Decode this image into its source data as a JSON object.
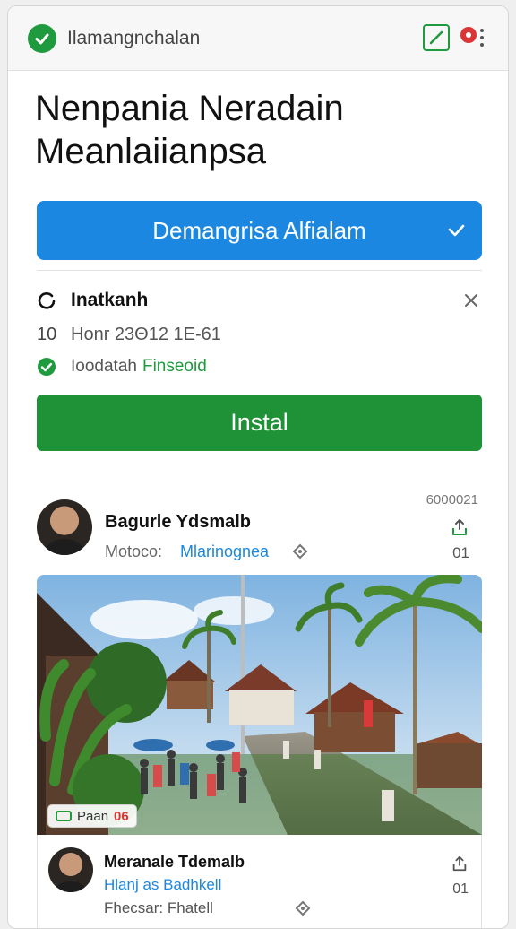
{
  "topbar": {
    "title": "Ilamangnchalan",
    "icons": [
      "check-circle-icon",
      "edit-icon",
      "record-icon",
      "more-vert-icon"
    ]
  },
  "headline": {
    "line1": "Nenpania Neradain",
    "line2": "Meanlaiianpsa"
  },
  "primary_button": {
    "label": "Demangrisa Alfialam"
  },
  "app_info": {
    "name": "Inatkanh",
    "count": "10",
    "meta": "Ηonr 23Θ12 1Ε-61",
    "status_label": "Ioodatah",
    "status_value": "Finseoid"
  },
  "install_button": {
    "label": "Instal"
  },
  "post1": {
    "count": "6000021",
    "author": "Bagurle Ydsmalb",
    "label": "Motoco:",
    "value": "Mlarinognea",
    "number": "01",
    "photo_badge": {
      "text": "Paan",
      "count": "06"
    }
  },
  "post2": {
    "author": "Meranale Tdemalb",
    "subtitle": "Hlanj as Badhkell",
    "label": "Fhecsar: Fhatell",
    "number": "01"
  },
  "colors": {
    "accent_blue": "#1c87e0",
    "accent_green": "#1f9238",
    "alert_red": "#d93636"
  }
}
